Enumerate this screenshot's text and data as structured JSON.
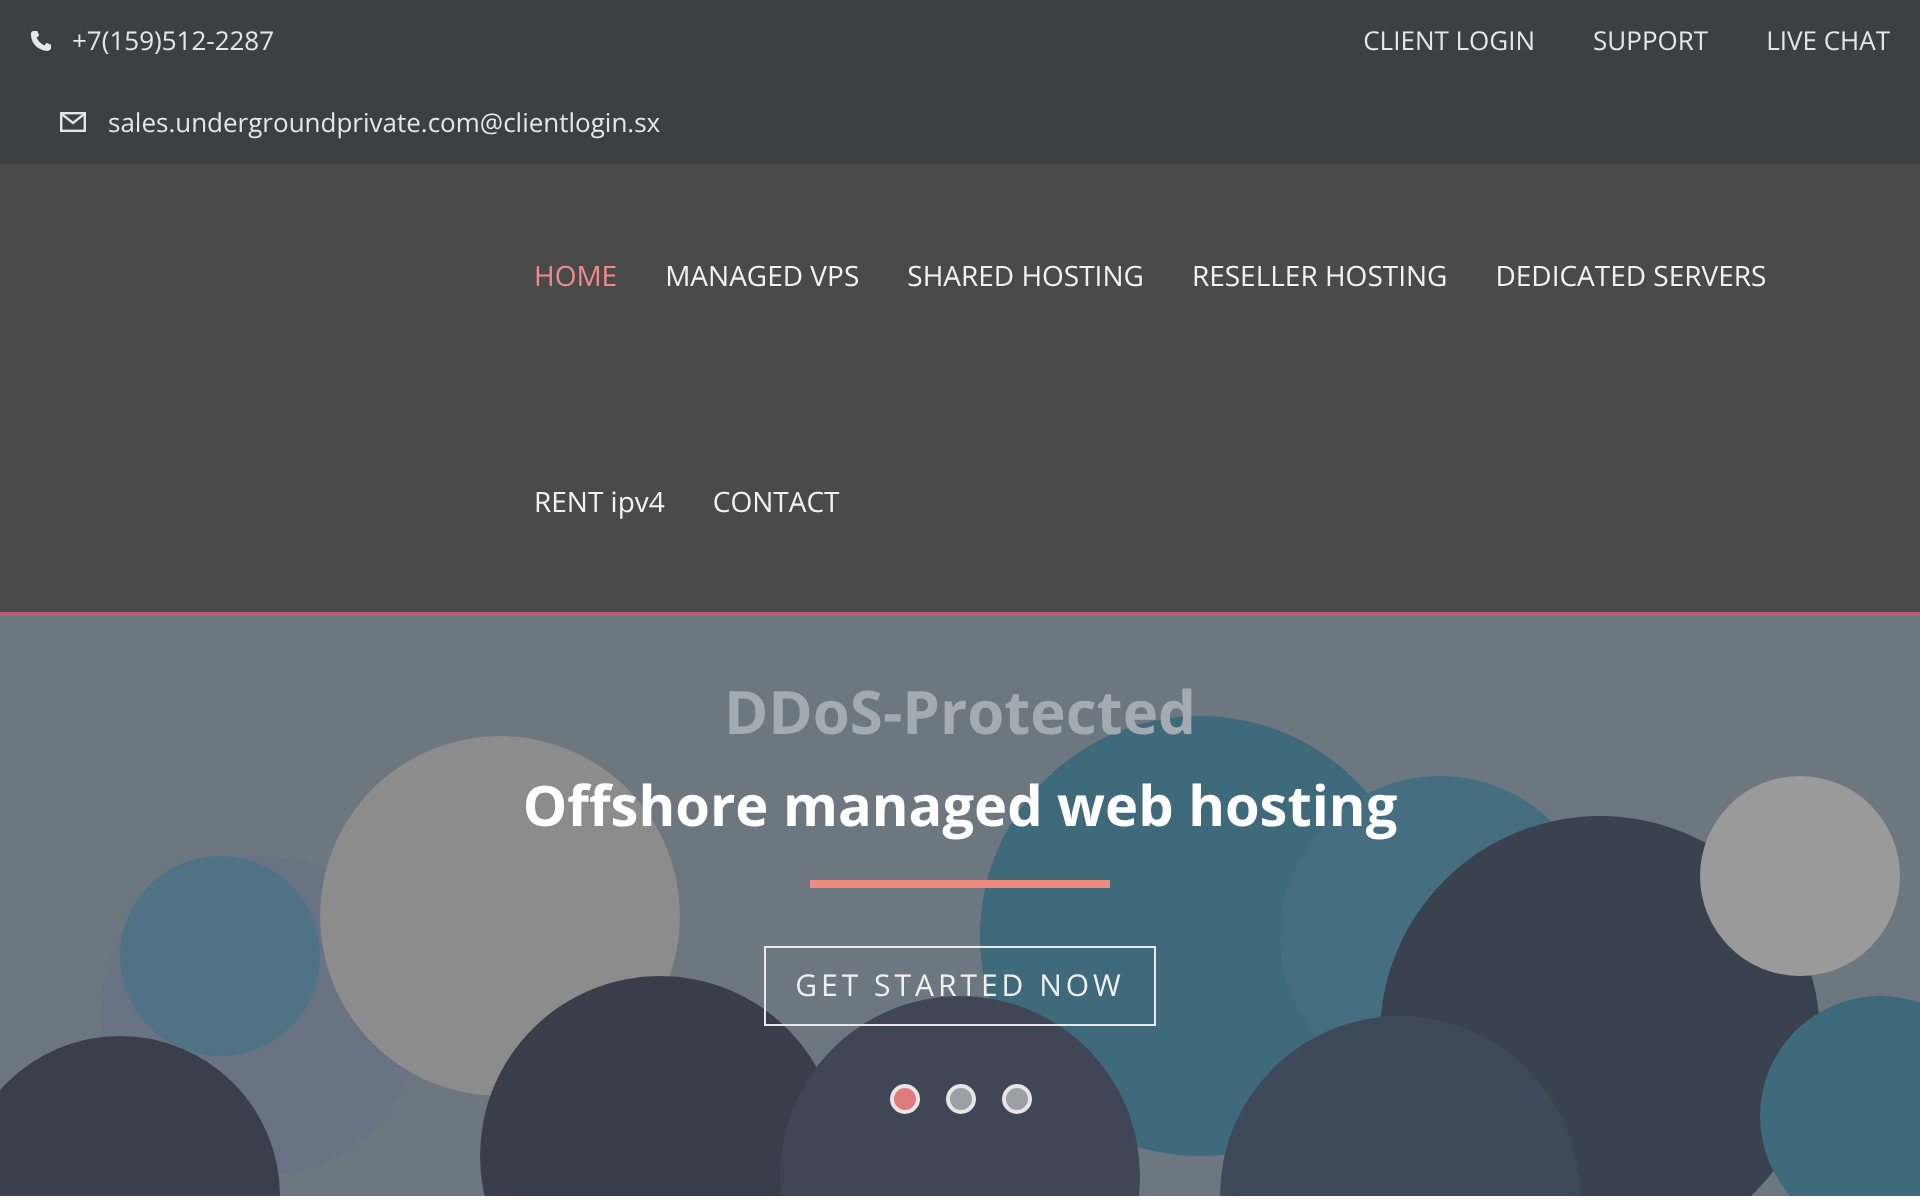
{
  "top_bar": {
    "phone": "+7(159)512-2287",
    "email": "sales.undergroundprivate.com@clientlogin.sx",
    "links": [
      "CLIENT LOGIN",
      "SUPPORT",
      "LIVE CHAT"
    ]
  },
  "nav": {
    "items": [
      {
        "label": "HOME",
        "selected": true
      },
      {
        "label": "MANAGED VPS",
        "selected": false
      },
      {
        "label": "SHARED HOSTING",
        "selected": false
      },
      {
        "label": "RESELLER HOSTING",
        "selected": false
      },
      {
        "label": "DEDICATED SERVERS",
        "selected": false
      },
      {
        "label": "RENT ipv4",
        "selected": false
      },
      {
        "label": "CONTACT",
        "selected": false
      }
    ]
  },
  "hero": {
    "faded_heading": "DDoS-Protected",
    "heading": "Offshore managed web hosting",
    "button": "GET STARTED NOW",
    "dots": [
      {
        "selected": true
      },
      {
        "selected": false
      },
      {
        "selected": false
      }
    ]
  }
}
